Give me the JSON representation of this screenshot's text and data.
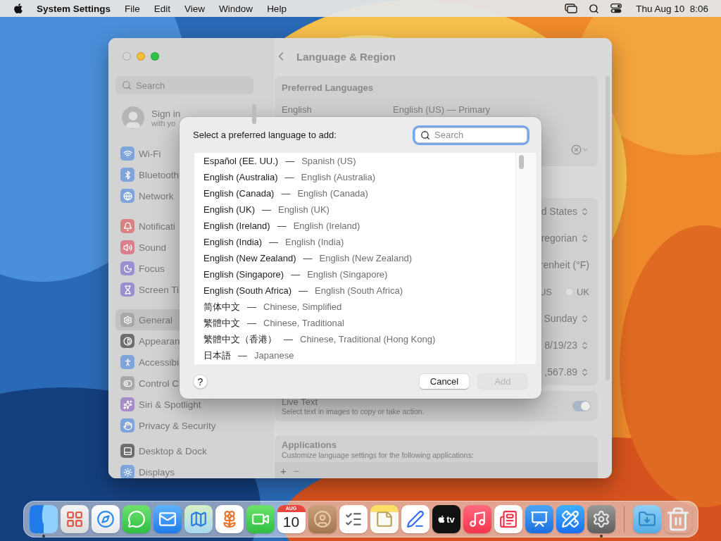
{
  "menu_bar": {
    "app_name": "System Settings",
    "menus": [
      "File",
      "Edit",
      "View",
      "Window",
      "Help"
    ],
    "clock": "Thu Aug 10  8:06"
  },
  "window": {
    "sidebar": {
      "search": {
        "placeholder": "Search"
      },
      "account": {
        "title": "Sign in",
        "subtitle": "with yo"
      },
      "groups": [
        {
          "items": [
            {
              "kind": "wifi",
              "label": "Wi-Fi",
              "color": "#7fa4d9",
              "selected": false
            },
            {
              "kind": "bluetooth",
              "label": "Bluetooth",
              "color": "#7fa4d9",
              "selected": false
            },
            {
              "kind": "network",
              "label": "Network",
              "color": "#7fa4d9",
              "selected": false
            }
          ]
        },
        {
          "items": [
            {
              "kind": "notifications",
              "label": "Notificati",
              "color": "#d98080",
              "selected": false
            },
            {
              "kind": "sound",
              "label": "Sound",
              "color": "#d9808f",
              "selected": false
            },
            {
              "kind": "focus",
              "label": "Focus",
              "color": "#9b8fd0",
              "selected": false
            },
            {
              "kind": "screentime",
              "label": "Screen Ti",
              "color": "#9b8fd0",
              "selected": false
            }
          ]
        },
        {
          "items": [
            {
              "kind": "general",
              "label": "General",
              "color": "#a8a8a8",
              "selected": true
            },
            {
              "kind": "appearance",
              "label": "Appearan",
              "color": "#6e6e6e",
              "selected": false
            },
            {
              "kind": "accessibility",
              "label": "Accessibi",
              "color": "#7fa4d9",
              "selected": false
            },
            {
              "kind": "controlcenter",
              "label": "Control C",
              "color": "#a8a8a8",
              "selected": false
            },
            {
              "kind": "siri",
              "label": "Siri & Spotlight",
              "color": "#a68cc8",
              "selected": false
            },
            {
              "kind": "privacy",
              "label": "Privacy & Security",
              "color": "#7fa4d9",
              "selected": false
            }
          ]
        },
        {
          "items": [
            {
              "kind": "desktopdock",
              "label": "Desktop & Dock",
              "color": "#6e6e6e",
              "selected": false
            },
            {
              "kind": "displays",
              "label": "Displays",
              "color": "#7fa4d9",
              "selected": false
            }
          ]
        }
      ]
    },
    "content": {
      "title": "Language & Region",
      "preferred_languages": {
        "heading": "Preferred Languages",
        "rows": [
          {
            "name": "English",
            "detail": "English (US) — Primary"
          }
        ]
      },
      "region_settings": [
        {
          "kind": "popup",
          "value": "d States"
        },
        {
          "kind": "popup",
          "value": "regorian"
        },
        {
          "kind": "text",
          "value": "renheit (°F)"
        },
        {
          "kind": "radios",
          "options": [
            {
              "label": "US"
            },
            {
              "label": "UK",
              "selected": false
            }
          ]
        },
        {
          "kind": "popup",
          "value": "Sunday"
        },
        {
          "kind": "popup",
          "value": "8/19/23"
        },
        {
          "kind": "popup",
          "value": ",567.89"
        }
      ],
      "live_text": {
        "title": "Live Text",
        "subtitle": "Select text in images to copy or take action.",
        "on": true
      },
      "applications": {
        "heading": "Applications",
        "subtitle": "Customize language settings for the following applications:",
        "tools": [
          "+",
          "−"
        ]
      }
    }
  },
  "dialog": {
    "title": "Select a preferred language to add:",
    "search": {
      "placeholder": "Search"
    },
    "languages": [
      {
        "name": "Español (EE. UU.)",
        "separator": "—",
        "english": "Spanish (US)"
      },
      {
        "name": "English (Australia)",
        "separator": "—",
        "english": "English (Australia)"
      },
      {
        "name": "English (Canada)",
        "separator": "—",
        "english": "English (Canada)"
      },
      {
        "name": "English (UK)",
        "separator": "—",
        "english": "English (UK)"
      },
      {
        "name": "English (Ireland)",
        "separator": "—",
        "english": "English (Ireland)"
      },
      {
        "name": "English (India)",
        "separator": "—",
        "english": "English (India)"
      },
      {
        "name": "English (New Zealand)",
        "separator": "—",
        "english": "English (New Zealand)"
      },
      {
        "name": "English (Singapore)",
        "separator": "—",
        "english": "English (Singapore)"
      },
      {
        "name": "English (South Africa)",
        "separator": "—",
        "english": "English (South Africa)"
      },
      {
        "name": "简体中文",
        "separator": "—",
        "english": "Chinese, Simplified"
      },
      {
        "name": "繁體中文",
        "separator": "—",
        "english": "Chinese, Traditional"
      },
      {
        "name": "繁體中文（香港）",
        "separator": "—",
        "english": "Chinese, Traditional (Hong Kong)"
      },
      {
        "name": "日本語",
        "separator": "—",
        "english": "Japanese"
      }
    ],
    "help": "?",
    "buttons": [
      {
        "label": "Cancel",
        "disabled": false
      },
      {
        "label": "Add",
        "disabled": true
      }
    ]
  },
  "dock": {
    "apps": [
      {
        "kind": "finder",
        "running": true
      },
      {
        "kind": "launchpad",
        "running": false
      },
      {
        "kind": "safari",
        "running": false
      },
      {
        "kind": "messages",
        "running": false
      },
      {
        "kind": "mail",
        "running": false
      },
      {
        "kind": "maps",
        "running": false
      },
      {
        "kind": "photos",
        "running": false
      },
      {
        "kind": "facetime",
        "running": false
      },
      {
        "kind": "calendar",
        "month": "AUG",
        "day": "10",
        "running": false
      },
      {
        "kind": "contacts",
        "running": false
      },
      {
        "kind": "reminders",
        "running": false
      },
      {
        "kind": "notes",
        "running": false
      },
      {
        "kind": "freeform",
        "running": false
      },
      {
        "kind": "tv",
        "label": "tv",
        "running": false
      },
      {
        "kind": "music",
        "running": false
      },
      {
        "kind": "news",
        "running": false
      },
      {
        "kind": "keynote",
        "running": false
      },
      {
        "kind": "appstore",
        "running": false
      },
      {
        "kind": "settings",
        "running": true
      }
    ],
    "stacks": [
      {
        "kind": "downloads"
      },
      {
        "kind": "trash"
      }
    ]
  }
}
